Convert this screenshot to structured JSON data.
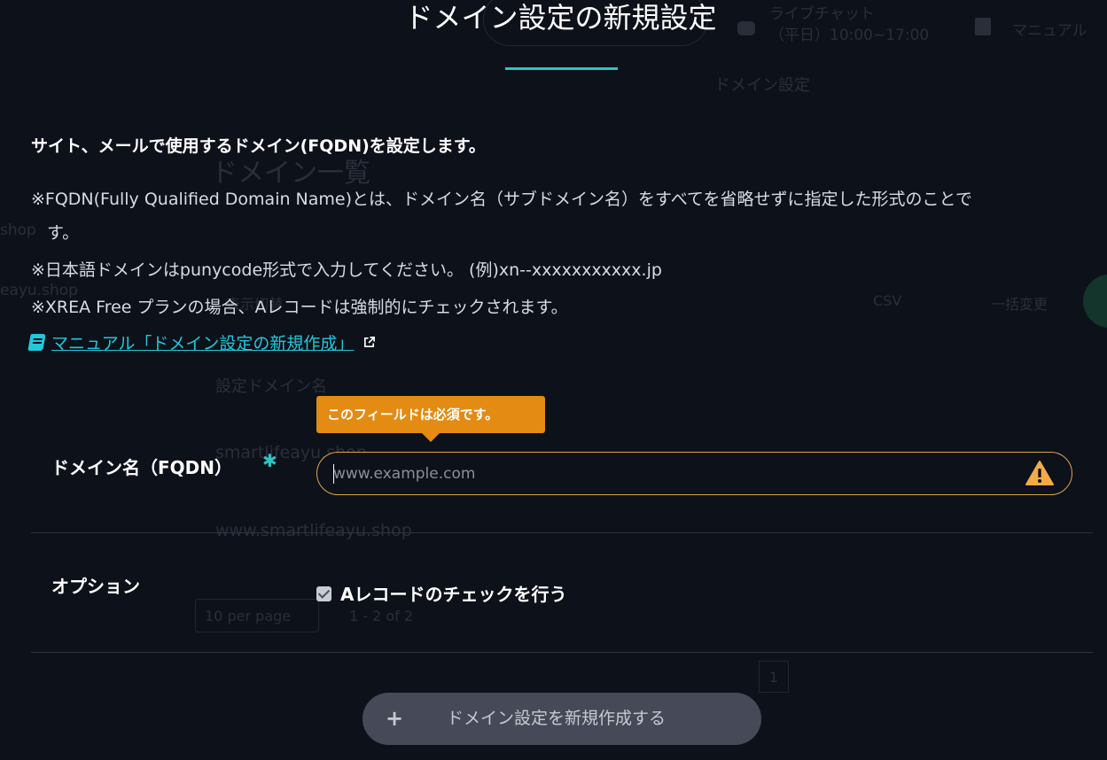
{
  "background": {
    "chat_label_1": "ライブチャット",
    "chat_label_2": "（平日）10:00~17:00",
    "manual_label": "マニュアル",
    "breadcrumb": "ドメイン設定",
    "heading": "ドメイン一覧",
    "side_1": "shop",
    "side_2": "eayu.shop",
    "filter_label": "表示切替",
    "csv_label": "CSV",
    "bulk_label": "一括変更",
    "column_header": "設定ドメイン名",
    "row_1": "smartlifeayu.shop",
    "row_2": "www.smartlifeayu.shop",
    "per_page": "10 per page",
    "range": "1 - 2 of 2",
    "page_number": "1"
  },
  "modal": {
    "title": "ドメイン設定の新規設定",
    "lead": "サイト、メールで使用するドメイン(FQDN)を設定します。",
    "note1_line1": "※FQDN(Fully Qualified Domain Name)とは、ドメイン名（サブドメイン名）をすべてを省略せずに指定した形式のことで",
    "note1_line2": "す。",
    "note2": "※日本語ドメインはpunycode形式で入力してください。 (例)xn--xxxxxxxxxxx.jp",
    "note3": "※XREA Free プランの場合、Aレコードは強制的にチェックされます。",
    "manual_link": "マニュアル「ドメイン設定の新規作成」",
    "tooltip": "このフィールドは必須です。",
    "domain_label": "ドメイン名（FQDN）",
    "required_mark": "✱",
    "domain_placeholder": "www.example.com",
    "domain_value": "",
    "option_label": "オプション",
    "a_record_label": "Aレコードのチェックを行う",
    "a_record_checked": true,
    "submit_label": "ドメイン設定を新規作成する"
  },
  "colors": {
    "background": "#0d111a",
    "accent": "#2fc4c4",
    "link": "#21c8dc",
    "warning": "#e38b12",
    "warning_border": "#e3a24a",
    "button": "#464a58"
  },
  "icons": [
    "book-icon",
    "external-link-icon",
    "warning-icon",
    "plus-icon",
    "checkbox-check-icon",
    "chat-icon"
  ]
}
